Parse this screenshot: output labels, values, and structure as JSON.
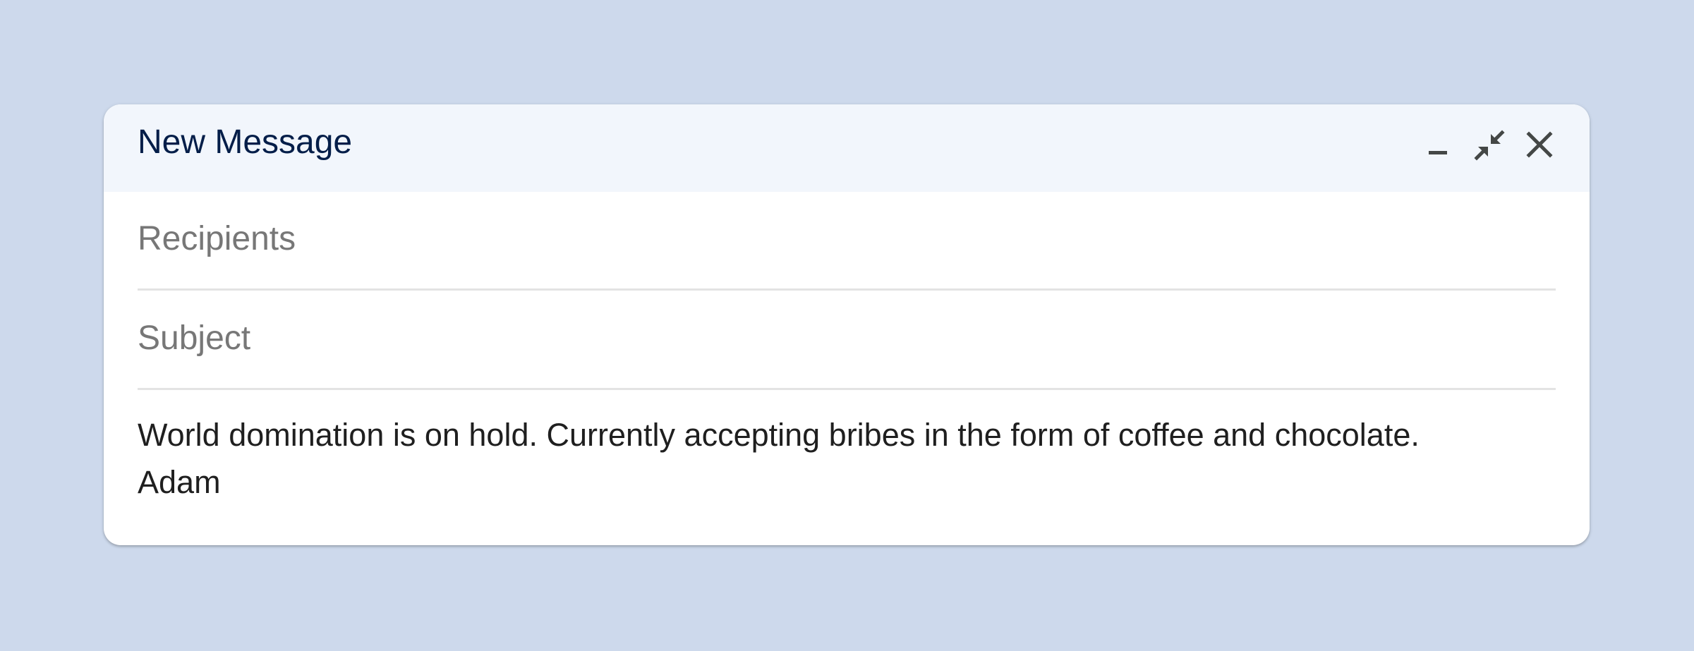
{
  "compose": {
    "title": "New Message",
    "controls": {
      "minimize_icon": "minimize-icon",
      "exit_fullscreen_icon": "collapse-arrows-icon",
      "close_icon": "close-icon"
    },
    "recipients": {
      "placeholder": "Recipients",
      "value": ""
    },
    "subject": {
      "placeholder": "Subject",
      "value": ""
    },
    "body": {
      "lines": [
        "World domination is on hold. Currently accepting bribes in the form of coffee and chocolate.",
        "Adam"
      ]
    }
  },
  "colors": {
    "page_background": "#cdd9ec",
    "header_background": "#f2f6fc",
    "title_color": "#041e49",
    "icon_color": "#444746",
    "placeholder_color": "#777777",
    "divider_color": "#e3e3e3"
  }
}
